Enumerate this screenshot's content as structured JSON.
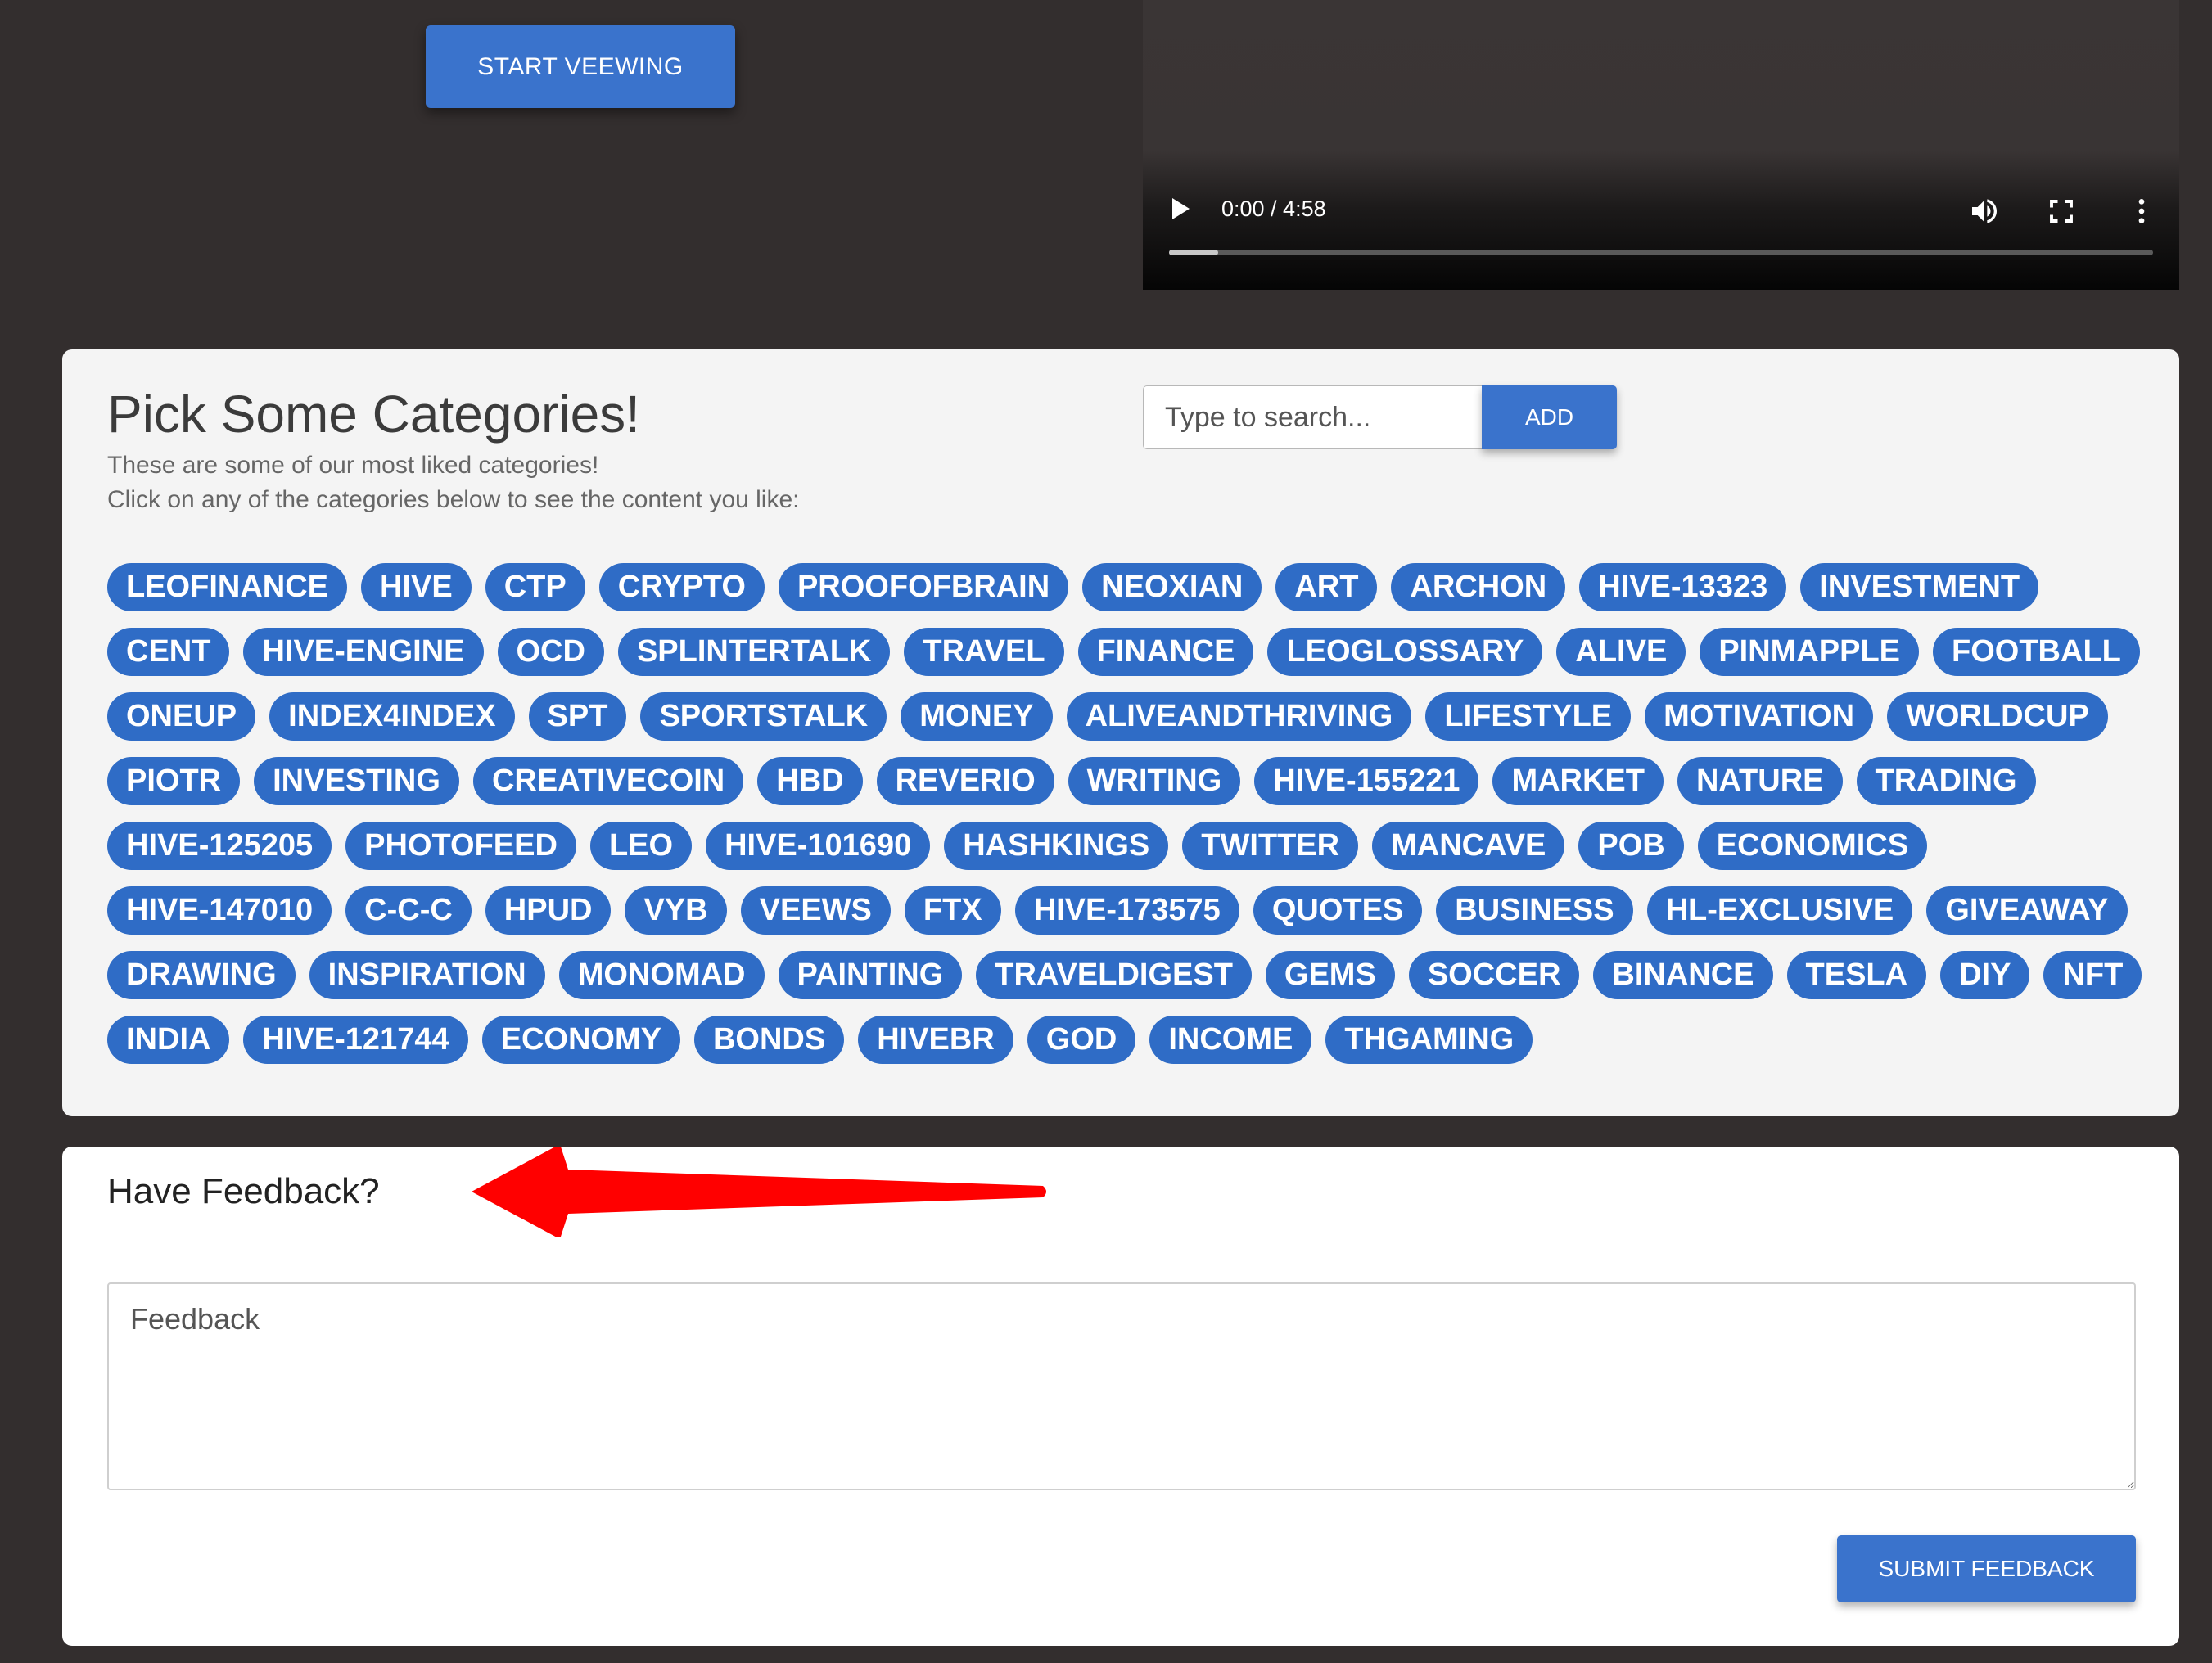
{
  "top": {
    "start_button_label": "START VEEWING"
  },
  "video": {
    "time_display": "0:00 / 4:58",
    "progress_fraction": 0.05,
    "controls": [
      "play-icon",
      "volume-icon",
      "fullscreen-icon",
      "more-options-icon"
    ]
  },
  "categories": {
    "title": "Pick Some Categories!",
    "subtitle_1": "These are some of our most liked categories!",
    "subtitle_2": "Click on any of the categories below to see the content you like:",
    "search_placeholder": "Type to search...",
    "add_label": "ADD",
    "tags": [
      "LEOFINANCE",
      "HIVE",
      "CTP",
      "CRYPTO",
      "PROOFOFBRAIN",
      "NEOXIAN",
      "ART",
      "ARCHON",
      "HIVE-13323",
      "INVESTMENT",
      "CENT",
      "HIVE-ENGINE",
      "OCD",
      "SPLINTERTALK",
      "TRAVEL",
      "FINANCE",
      "LEOGLOSSARY",
      "ALIVE",
      "PINMAPPLE",
      "FOOTBALL",
      "ONEUP",
      "INDEX4INDEX",
      "SPT",
      "SPORTSTALK",
      "MONEY",
      "ALIVEANDTHRIVING",
      "LIFESTYLE",
      "MOTIVATION",
      "WORLDCUP",
      "PIOTR",
      "INVESTING",
      "CREATIVECOIN",
      "HBD",
      "REVERIO",
      "WRITING",
      "HIVE-155221",
      "MARKET",
      "NATURE",
      "TRADING",
      "HIVE-125205",
      "PHOTOFEED",
      "LEO",
      "HIVE-101690",
      "HASHKINGS",
      "TWITTER",
      "MANCAVE",
      "POB",
      "ECONOMICS",
      "HIVE-147010",
      "C-C-C",
      "HPUD",
      "VYB",
      "VEEWS",
      "FTX",
      "HIVE-173575",
      "QUOTES",
      "BUSINESS",
      "HL-EXCLUSIVE",
      "GIVEAWAY",
      "DRAWING",
      "INSPIRATION",
      "MONOMAD",
      "PAINTING",
      "TRAVELDIGEST",
      "GEMS",
      "SOCCER",
      "BINANCE",
      "TESLA",
      "DIY",
      "NFT",
      "INDIA",
      "HIVE-121744",
      "ECONOMY",
      "BONDS",
      "HIVEBR",
      "GOD",
      "INCOME",
      "THGAMING"
    ]
  },
  "feedback": {
    "title": "Have Feedback?",
    "placeholder": "Feedback",
    "submit_label": "SUBMIT FEEDBACK",
    "annotation_arrow_color": "#ff0000"
  },
  "colors": {
    "page_background": "#332e2e",
    "button_blue": "#3a73cc",
    "chip_blue": "#2f6cc6"
  }
}
